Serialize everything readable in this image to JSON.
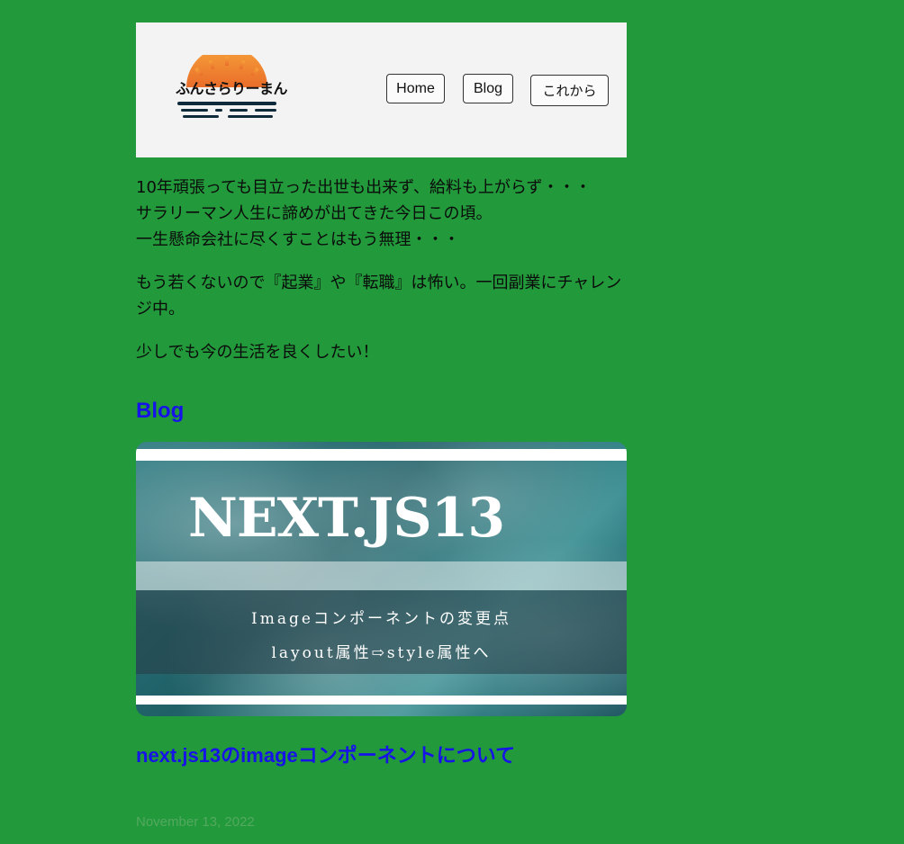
{
  "header": {
    "logo_text": "ふんさらりーまん",
    "nav": {
      "home": "Home",
      "blog": "Blog",
      "future": "これから"
    }
  },
  "intro": {
    "lines": [
      "10年頑張っても目立った出世も出来ず、給料も上がらず・・・",
      "サラリーマン人生に諦めが出てきた今日この頃。",
      "一生懸命会社に尽くすことはもう無理・・・"
    ],
    "paragraph2": "もう若くないので『起業』や『転職』は怖い。一回副業にチャレンジ中。",
    "paragraph3": "少しでも今の生活を良くしたい！"
  },
  "blog": {
    "section_title": "Blog",
    "post": {
      "image_title": "NEXT.JS13",
      "image_sub1": "Imageコンポーネントの変更点",
      "image_sub2": "layout属性⇨style属性へ",
      "title": "next.js13のimageコンポーネントについて",
      "date": "November 13, 2022"
    }
  },
  "colors": {
    "background": "#22993a",
    "header_bg": "#f3f3f3",
    "link": "#1613e8",
    "date": "#53a95f"
  }
}
